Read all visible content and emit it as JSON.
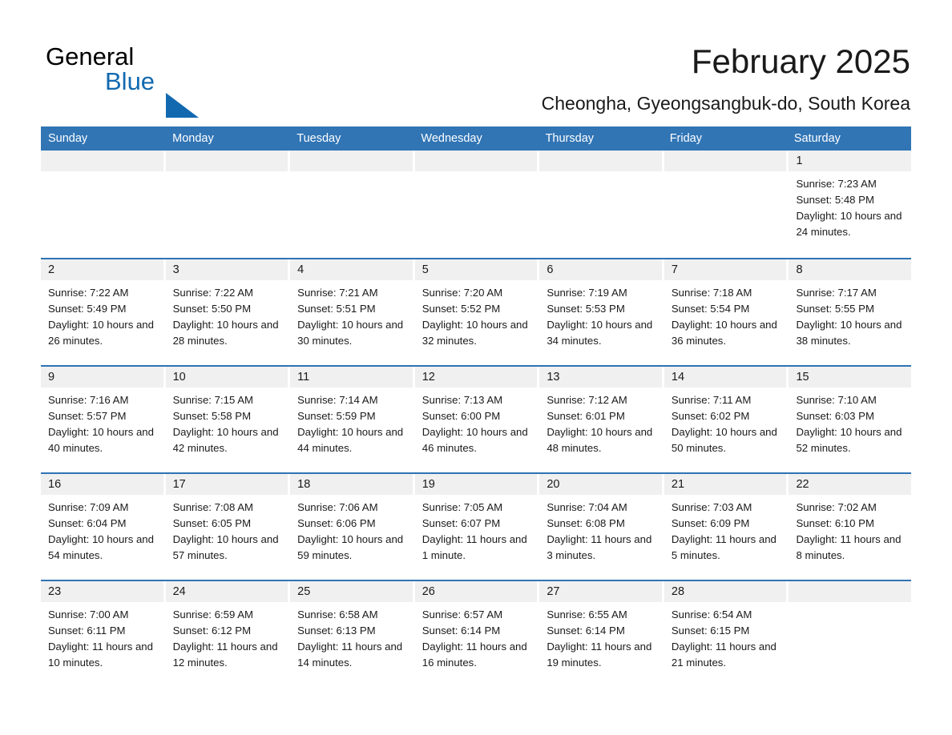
{
  "brand": {
    "name_part1": "General",
    "name_part2": "Blue",
    "triangle_icon": "blue-triangle-icon",
    "accent_color": "#1269b0"
  },
  "header": {
    "month_title": "February 2025",
    "location": "Cheongha, Gyeongsangbuk-do, South Korea"
  },
  "calendar": {
    "header_bg": "#3175b5",
    "row_border_color": "#2f73b4",
    "day_band_bg": "#f0f0f0",
    "weekdays": [
      "Sunday",
      "Monday",
      "Tuesday",
      "Wednesday",
      "Thursday",
      "Friday",
      "Saturday"
    ],
    "weeks": [
      [
        {
          "day": "",
          "empty": true
        },
        {
          "day": "",
          "empty": true
        },
        {
          "day": "",
          "empty": true
        },
        {
          "day": "",
          "empty": true
        },
        {
          "day": "",
          "empty": true
        },
        {
          "day": "",
          "empty": true
        },
        {
          "day": "1",
          "sunrise": "Sunrise: 7:23 AM",
          "sunset": "Sunset: 5:48 PM",
          "daylight": "Daylight: 10 hours and 24 minutes."
        }
      ],
      [
        {
          "day": "2",
          "sunrise": "Sunrise: 7:22 AM",
          "sunset": "Sunset: 5:49 PM",
          "daylight": "Daylight: 10 hours and 26 minutes."
        },
        {
          "day": "3",
          "sunrise": "Sunrise: 7:22 AM",
          "sunset": "Sunset: 5:50 PM",
          "daylight": "Daylight: 10 hours and 28 minutes."
        },
        {
          "day": "4",
          "sunrise": "Sunrise: 7:21 AM",
          "sunset": "Sunset: 5:51 PM",
          "daylight": "Daylight: 10 hours and 30 minutes."
        },
        {
          "day": "5",
          "sunrise": "Sunrise: 7:20 AM",
          "sunset": "Sunset: 5:52 PM",
          "daylight": "Daylight: 10 hours and 32 minutes."
        },
        {
          "day": "6",
          "sunrise": "Sunrise: 7:19 AM",
          "sunset": "Sunset: 5:53 PM",
          "daylight": "Daylight: 10 hours and 34 minutes."
        },
        {
          "day": "7",
          "sunrise": "Sunrise: 7:18 AM",
          "sunset": "Sunset: 5:54 PM",
          "daylight": "Daylight: 10 hours and 36 minutes."
        },
        {
          "day": "8",
          "sunrise": "Sunrise: 7:17 AM",
          "sunset": "Sunset: 5:55 PM",
          "daylight": "Daylight: 10 hours and 38 minutes."
        }
      ],
      [
        {
          "day": "9",
          "sunrise": "Sunrise: 7:16 AM",
          "sunset": "Sunset: 5:57 PM",
          "daylight": "Daylight: 10 hours and 40 minutes."
        },
        {
          "day": "10",
          "sunrise": "Sunrise: 7:15 AM",
          "sunset": "Sunset: 5:58 PM",
          "daylight": "Daylight: 10 hours and 42 minutes."
        },
        {
          "day": "11",
          "sunrise": "Sunrise: 7:14 AM",
          "sunset": "Sunset: 5:59 PM",
          "daylight": "Daylight: 10 hours and 44 minutes."
        },
        {
          "day": "12",
          "sunrise": "Sunrise: 7:13 AM",
          "sunset": "Sunset: 6:00 PM",
          "daylight": "Daylight: 10 hours and 46 minutes."
        },
        {
          "day": "13",
          "sunrise": "Sunrise: 7:12 AM",
          "sunset": "Sunset: 6:01 PM",
          "daylight": "Daylight: 10 hours and 48 minutes."
        },
        {
          "day": "14",
          "sunrise": "Sunrise: 7:11 AM",
          "sunset": "Sunset: 6:02 PM",
          "daylight": "Daylight: 10 hours and 50 minutes."
        },
        {
          "day": "15",
          "sunrise": "Sunrise: 7:10 AM",
          "sunset": "Sunset: 6:03 PM",
          "daylight": "Daylight: 10 hours and 52 minutes."
        }
      ],
      [
        {
          "day": "16",
          "sunrise": "Sunrise: 7:09 AM",
          "sunset": "Sunset: 6:04 PM",
          "daylight": "Daylight: 10 hours and 54 minutes."
        },
        {
          "day": "17",
          "sunrise": "Sunrise: 7:08 AM",
          "sunset": "Sunset: 6:05 PM",
          "daylight": "Daylight: 10 hours and 57 minutes."
        },
        {
          "day": "18",
          "sunrise": "Sunrise: 7:06 AM",
          "sunset": "Sunset: 6:06 PM",
          "daylight": "Daylight: 10 hours and 59 minutes."
        },
        {
          "day": "19",
          "sunrise": "Sunrise: 7:05 AM",
          "sunset": "Sunset: 6:07 PM",
          "daylight": "Daylight: 11 hours and 1 minute."
        },
        {
          "day": "20",
          "sunrise": "Sunrise: 7:04 AM",
          "sunset": "Sunset: 6:08 PM",
          "daylight": "Daylight: 11 hours and 3 minutes."
        },
        {
          "day": "21",
          "sunrise": "Sunrise: 7:03 AM",
          "sunset": "Sunset: 6:09 PM",
          "daylight": "Daylight: 11 hours and 5 minutes."
        },
        {
          "day": "22",
          "sunrise": "Sunrise: 7:02 AM",
          "sunset": "Sunset: 6:10 PM",
          "daylight": "Daylight: 11 hours and 8 minutes."
        }
      ],
      [
        {
          "day": "23",
          "sunrise": "Sunrise: 7:00 AM",
          "sunset": "Sunset: 6:11 PM",
          "daylight": "Daylight: 11 hours and 10 minutes."
        },
        {
          "day": "24",
          "sunrise": "Sunrise: 6:59 AM",
          "sunset": "Sunset: 6:12 PM",
          "daylight": "Daylight: 11 hours and 12 minutes."
        },
        {
          "day": "25",
          "sunrise": "Sunrise: 6:58 AM",
          "sunset": "Sunset: 6:13 PM",
          "daylight": "Daylight: 11 hours and 14 minutes."
        },
        {
          "day": "26",
          "sunrise": "Sunrise: 6:57 AM",
          "sunset": "Sunset: 6:14 PM",
          "daylight": "Daylight: 11 hours and 16 minutes."
        },
        {
          "day": "27",
          "sunrise": "Sunrise: 6:55 AM",
          "sunset": "Sunset: 6:14 PM",
          "daylight": "Daylight: 11 hours and 19 minutes."
        },
        {
          "day": "28",
          "sunrise": "Sunrise: 6:54 AM",
          "sunset": "Sunset: 6:15 PM",
          "daylight": "Daylight: 11 hours and 21 minutes."
        },
        {
          "day": "",
          "empty": true
        }
      ]
    ]
  }
}
